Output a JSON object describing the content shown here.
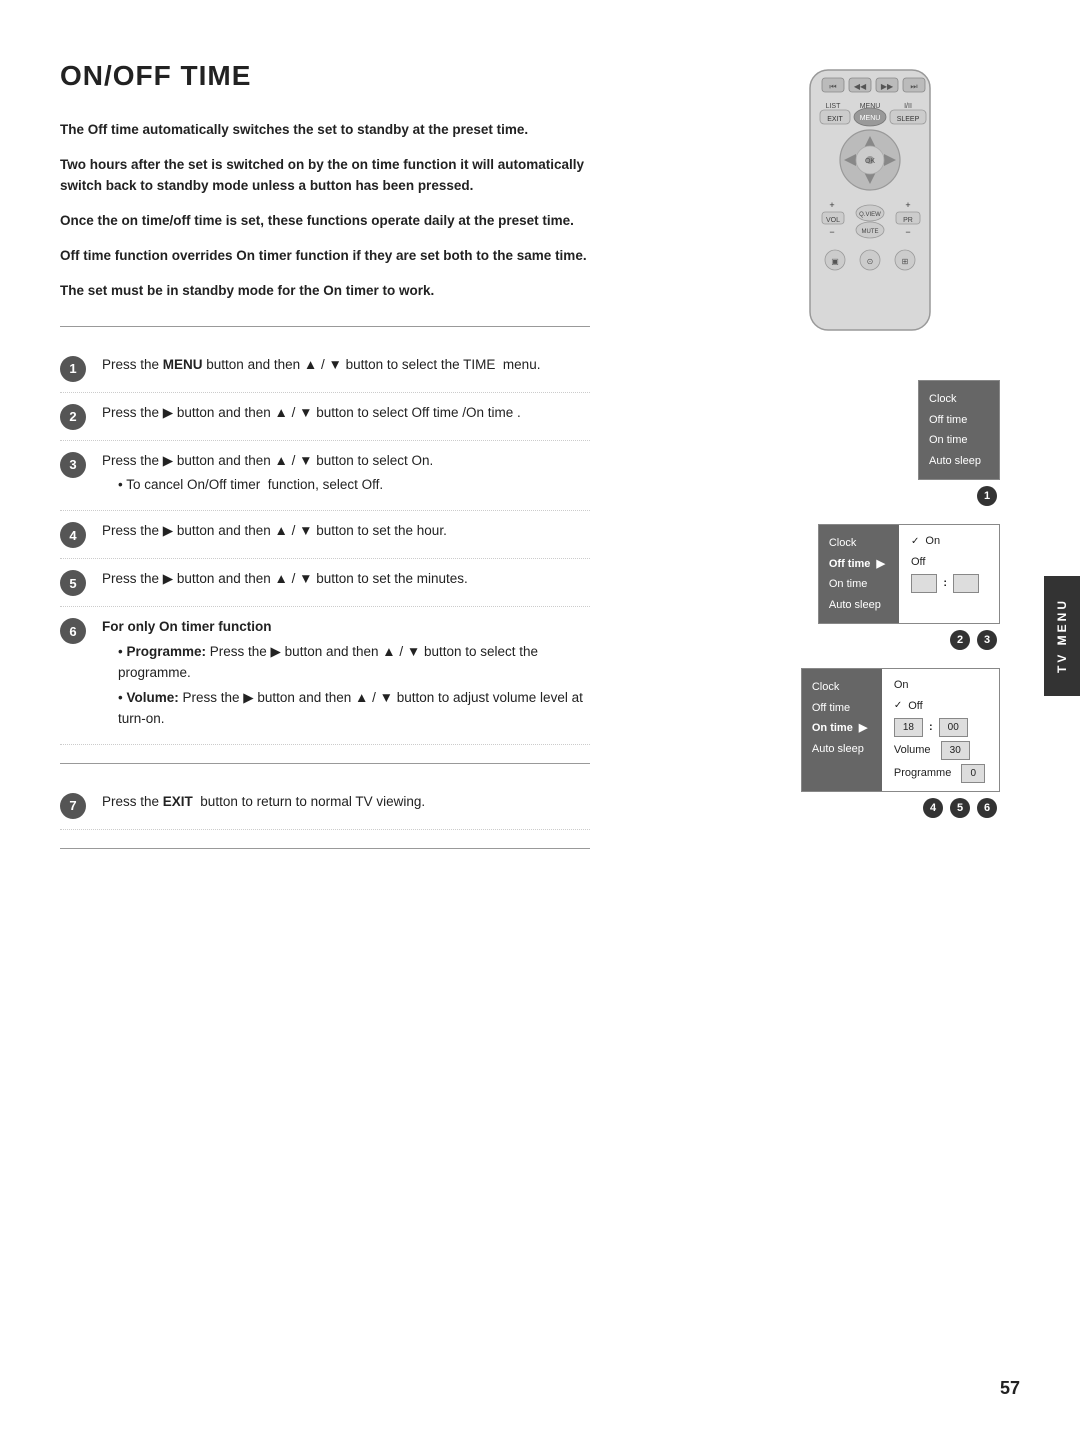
{
  "page": {
    "title": "ON/OFF TIME",
    "number": "57"
  },
  "tv_menu_label": "TV MENU",
  "intro_paragraphs": [
    "The Off time automatically switches the set to standby at the preset time.",
    "Two hours after the set is switched on by the on time function it will automatically switch back to standby mode unless a button has been pressed.",
    "Once the on time/off time is set, these functions operate daily at the preset time.",
    "Off time function overrides On timer function if they are set both to the same time.",
    "The set must be in standby mode for the On timer to work."
  ],
  "steps": [
    {
      "num": "1",
      "text_parts": [
        {
          "text": "Press the ",
          "bold": false
        },
        {
          "text": "MENU",
          "bold": true
        },
        {
          "text": " button and then ▲ / ▼ button to select the TIME  menu.",
          "bold": false
        }
      ]
    },
    {
      "num": "2",
      "text_parts": [
        {
          "text": "Press the ▶ button and then ▲ / ▼ button to select Off time /On time .",
          "bold": false
        }
      ]
    },
    {
      "num": "3",
      "text_parts": [
        {
          "text": "Press the ▶ button and then ▲ / ▼ button to select On.",
          "bold": false
        }
      ],
      "sub": [
        "• To cancel On/Off timer  function, select Off."
      ]
    },
    {
      "num": "4",
      "text_parts": [
        {
          "text": "Press the ▶ button and then ▲ / ▼ button to set the hour.",
          "bold": false
        }
      ]
    },
    {
      "num": "5",
      "text_parts": [
        {
          "text": "Press the ▶ button and then ▲ / ▼ button to set the minutes.",
          "bold": false
        }
      ]
    },
    {
      "num": "6",
      "header": "For only On timer function",
      "sub_bold": [
        {
          "label": "Programme:",
          "text": " Press the ▶ button and then ▲ / ▼ button to select the programme."
        },
        {
          "label": "Volume:",
          "text": " Press the ▶ button and then ▲ / ▼ button to adjust volume level at turn-on."
        }
      ]
    },
    {
      "num": "7",
      "text_parts": [
        {
          "text": "Press the ",
          "bold": false
        },
        {
          "text": "EXIT",
          "bold": true
        },
        {
          "text": "  button to return to normal TV viewing.",
          "bold": false
        }
      ]
    }
  ],
  "screen1": {
    "left_items": [
      "Clock",
      "Off time",
      "On time",
      "Auto sleep"
    ],
    "right_items": [],
    "badge": "1"
  },
  "screen2": {
    "left_items": [
      "Clock",
      "Off time",
      "On time",
      "Auto sleep"
    ],
    "active_left": "Off time",
    "right_items": [
      "√ On",
      "Off",
      "__ : __"
    ],
    "badges": [
      "2",
      "3"
    ]
  },
  "screen3": {
    "left_items": [
      "Clock",
      "Off time",
      "On time",
      "Auto sleep"
    ],
    "active_left": "On time",
    "right_items": [
      "On",
      "√ Off",
      "18 : 00",
      "Volume 30",
      "Programme 0"
    ],
    "badges": [
      "4",
      "5",
      "6"
    ]
  }
}
